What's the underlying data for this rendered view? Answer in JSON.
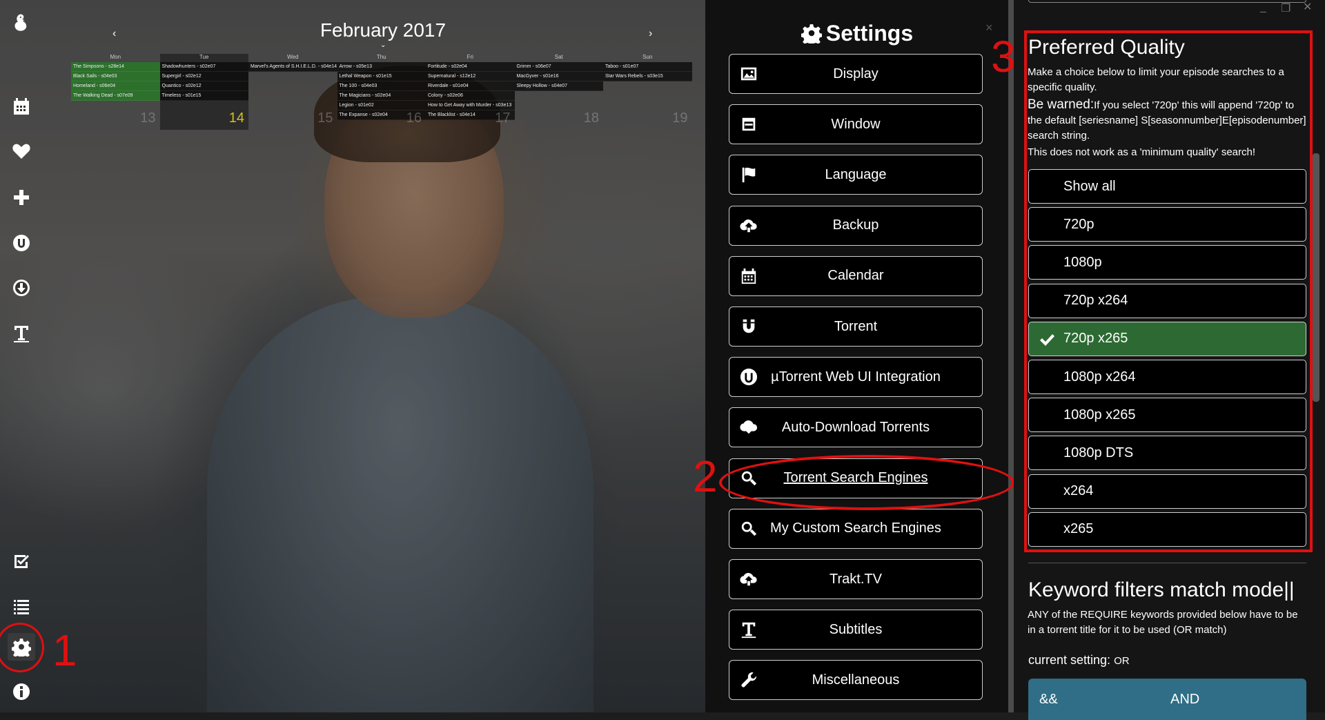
{
  "calendar": {
    "month_title": "February 2017",
    "prev": "‹",
    "next": "›",
    "days": [
      {
        "name": "Mon",
        "num": "13",
        "today": false,
        "episodes": [
          {
            "t": "The Simpsons - s28e14",
            "seen": true
          },
          {
            "t": "Black Sails - s04e03",
            "seen": true
          },
          {
            "t": "Homeland - s06e04",
            "seen": true
          },
          {
            "t": "The Walking Dead - s07e09",
            "seen": true
          }
        ]
      },
      {
        "name": "Tue",
        "num": "14",
        "today": true,
        "episodes": [
          {
            "t": "Shadowhunters - s02e07",
            "seen": false
          },
          {
            "t": "Supergirl - s02e12",
            "seen": false
          },
          {
            "t": "Quantico - s02e12",
            "seen": false
          },
          {
            "t": "Timeless - s01e15",
            "seen": false
          }
        ]
      },
      {
        "name": "Wed",
        "num": "15",
        "today": false,
        "episodes": [
          {
            "t": "Marvel's Agents of S.H.I.E.L.D. - s04e14",
            "seen": false
          }
        ]
      },
      {
        "name": "Thu",
        "num": "16",
        "today": false,
        "episodes": [
          {
            "t": "Arrow - s05e13",
            "seen": false
          },
          {
            "t": "Lethal Weapon - s01e15",
            "seen": false
          },
          {
            "t": "The 100 - s04e03",
            "seen": false
          },
          {
            "t": "The Magicians - s02e04",
            "seen": false
          },
          {
            "t": "Legion - s01e02",
            "seen": false
          },
          {
            "t": "The Expanse - s02e04",
            "seen": false
          }
        ]
      },
      {
        "name": "Fri",
        "num": "17",
        "today": false,
        "episodes": [
          {
            "t": "Fortitude - s02e04",
            "seen": false
          },
          {
            "t": "Supernatural - s12e12",
            "seen": false
          },
          {
            "t": "Riverdale - s01e04",
            "seen": false
          },
          {
            "t": "Colony - s02e06",
            "seen": false
          },
          {
            "t": "How to Get Away with Murder - s03e13",
            "seen": false
          },
          {
            "t": "The Blacklist - s04e14",
            "seen": false
          }
        ]
      },
      {
        "name": "Sat",
        "num": "18",
        "today": false,
        "episodes": [
          {
            "t": "Grimm - s06e07",
            "seen": false
          },
          {
            "t": "MacGyver - s01e16",
            "seen": false
          },
          {
            "t": "Sleepy Hollow - s04e07",
            "seen": false
          }
        ]
      },
      {
        "name": "Sun",
        "num": "19",
        "today": false,
        "episodes": [
          {
            "t": "Taboo - s01e07",
            "seen": false
          },
          {
            "t": "Star Wars Rebels - s03e15",
            "seen": false
          }
        ]
      }
    ]
  },
  "annotations": {
    "one": "1",
    "two": "2",
    "three": "3"
  },
  "settings": {
    "title": "Settings",
    "close": "×",
    "buttons": [
      {
        "label": "Display",
        "icon": "image-icon"
      },
      {
        "label": "Window",
        "icon": "window-icon"
      },
      {
        "label": "Language",
        "icon": "flag-icon"
      },
      {
        "label": "Backup",
        "icon": "cloud-upload-icon"
      },
      {
        "label": "Calendar",
        "icon": "calendar-icon"
      },
      {
        "label": "Torrent",
        "icon": "magnet-icon"
      },
      {
        "label": "µTorrent Web UI Integration",
        "icon": "utorrent-icon"
      },
      {
        "label": "Auto-Download Torrents",
        "icon": "cloud-download-icon"
      },
      {
        "label": "Torrent Search Engines",
        "icon": "search-icon",
        "active": true
      },
      {
        "label": "My Custom Search Engines",
        "icon": "search-icon"
      },
      {
        "label": "Trakt.TV",
        "icon": "cloud-upload-icon"
      },
      {
        "label": "Subtitles",
        "icon": "text-icon"
      },
      {
        "label": "Miscellaneous",
        "icon": "wrench-icon"
      }
    ]
  },
  "preferred_quality": {
    "title": "Preferred Quality",
    "desc": "Make a choice below to limit your episode searches to a specific quality.",
    "warn_label": "Be warned:",
    "warn_text": "If you select '720p' this will append '720p' to the default [seriesname] S[seasonnumber]E[episodenumber] search string.",
    "note": "This does not work as a 'minimum quality' search!",
    "options": [
      "Show all",
      "720p",
      "1080p",
      "720p x264",
      "720p x265",
      "1080p x264",
      "1080p x265",
      "1080p DTS",
      "x264",
      "x265"
    ],
    "selected": "720p x265"
  },
  "keyword_filters": {
    "title": "Keyword filters match mode||",
    "desc": "ANY of the REQUIRE keywords provided below have to be in a torrent title for it to be used (OR match)",
    "current_label": "current setting:",
    "current_value": "OR",
    "toggle_symbol": "&&",
    "toggle_label": "AND"
  },
  "window_controls": {
    "minimize": "_",
    "restore": "❐",
    "close": "✕"
  }
}
